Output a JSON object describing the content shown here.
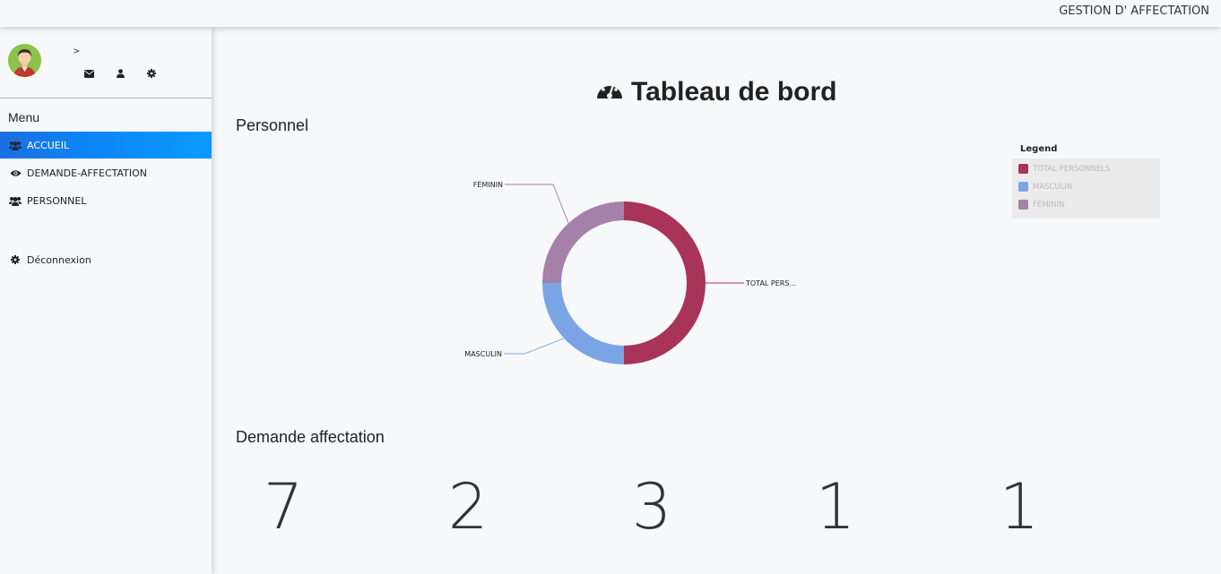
{
  "header": {
    "app_title": "GESTION D' AFFECTATION"
  },
  "sidebar": {
    "user_arrow": ">",
    "user_icons": [
      "envelope-icon",
      "user-icon",
      "gear-icon"
    ],
    "menu_title": "Menu",
    "items": [
      {
        "label": "ACCUEIL",
        "icon": "users-icon",
        "active": true
      },
      {
        "label": "DEMANDE-AFFECTATION",
        "icon": "eye-icon",
        "active": false
      },
      {
        "label": "PERSONNEL",
        "icon": "users-icon",
        "active": false
      }
    ],
    "logout": {
      "label": "Déconnexion",
      "icon": "gear-icon"
    }
  },
  "main": {
    "title": "Tableau de bord",
    "title_icon": "dashboard-gauge-icon",
    "sections": {
      "personnel": "Personnel",
      "demande": "Demande affectation"
    },
    "stats": [
      "7",
      "2",
      "3",
      "1",
      "1"
    ]
  },
  "chart_data": {
    "type": "pie",
    "donut": true,
    "categories": [
      "TOTAL PERSONNELS",
      "MASCULIN",
      "FÉMININ"
    ],
    "values": [
      4,
      2,
      2
    ],
    "slice_labels": [
      "TOTAL PERS...",
      "MASCULIN",
      "FÉMININ"
    ],
    "colors": [
      "#a8345a",
      "#7aa4e4",
      "#a580a8"
    ],
    "legend": {
      "title": "Legend",
      "placement": "top-right"
    }
  }
}
